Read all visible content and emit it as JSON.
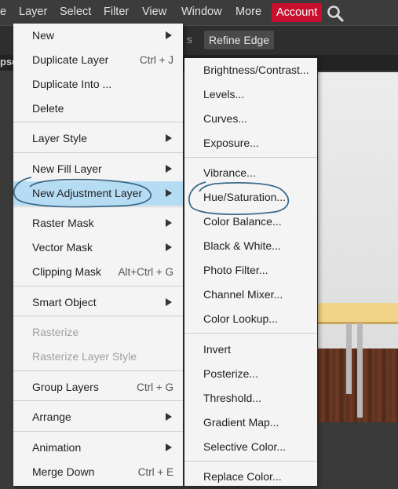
{
  "menubar": {
    "items": [
      "e",
      "Layer",
      "Select",
      "Filter",
      "View",
      "Window",
      "More"
    ],
    "account": "Account",
    "search_icon": "search-icon"
  },
  "optionsbar": {
    "refine_edge": "Refine Edge",
    "partial_text": "s"
  },
  "doctab": {
    "partial_title": "pse"
  },
  "layer_menu": {
    "items": [
      {
        "label": "New",
        "submenu": true
      },
      {
        "label": "Duplicate Layer",
        "shortcut": "Ctrl + J"
      },
      {
        "label": "Duplicate Into ..."
      },
      {
        "label": "Delete"
      },
      {
        "label": "Layer Style",
        "submenu": true
      },
      {
        "label": "New Fill Layer",
        "submenu": true
      },
      {
        "label": "New Adjustment Layer",
        "submenu": true,
        "highlighted": true
      },
      {
        "label": "Raster Mask",
        "submenu": true
      },
      {
        "label": "Vector Mask",
        "submenu": true
      },
      {
        "label": "Clipping Mask",
        "shortcut": "Alt+Ctrl + G"
      },
      {
        "label": "Smart Object",
        "submenu": true
      },
      {
        "label": "Rasterize",
        "disabled": true
      },
      {
        "label": "Rasterize Layer Style",
        "disabled": true
      },
      {
        "label": "Group Layers",
        "shortcut": "Ctrl + G"
      },
      {
        "label": "Arrange",
        "submenu": true
      },
      {
        "label": "Animation",
        "submenu": true
      },
      {
        "label": "Merge Down",
        "shortcut": "Ctrl + E"
      }
    ]
  },
  "adjustment_menu": {
    "items": [
      "Brightness/Contrast...",
      "Levels...",
      "Curves...",
      "Exposure...",
      "Vibrance...",
      "Hue/Saturation...",
      "Color Balance...",
      "Black & White...",
      "Photo Filter...",
      "Channel Mixer...",
      "Color Lookup...",
      "Invert",
      "Posterize...",
      "Threshold...",
      "Gradient Map...",
      "Selective Color...",
      "Replace Color..."
    ]
  },
  "colors": {
    "account_bg": "#c8102e",
    "highlight": "#b6dcf4",
    "menu_bg": "#f4f4f4",
    "annotation_stroke": "#3c6a8a"
  }
}
